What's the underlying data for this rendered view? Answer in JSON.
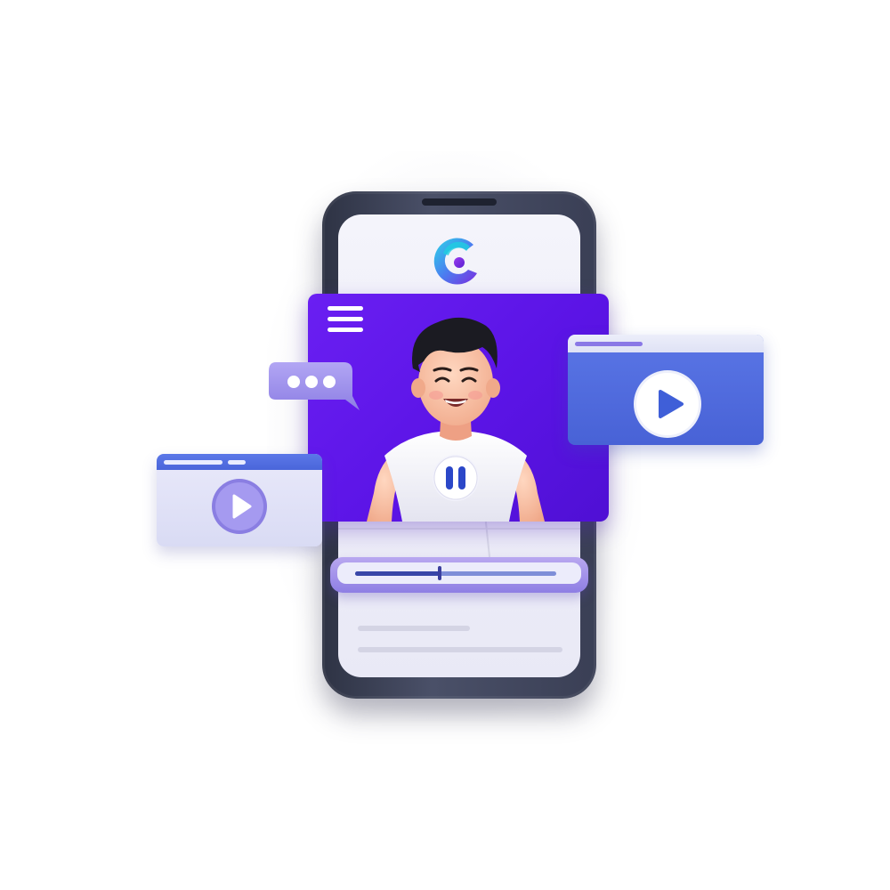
{
  "scene": "phone-video-app-illustration",
  "app_logo": {
    "icon": "c-logo-icon",
    "letter": "C"
  },
  "main_video": {
    "menu_icon": "hamburger-menu-icon",
    "control_icon": "pause-icon",
    "state": "playing"
  },
  "playback": {
    "progress": 0.42
  },
  "chat": {
    "icon": "chat-typing-icon"
  },
  "side_windows": [
    {
      "name": "right",
      "icon": "play-icon"
    },
    {
      "name": "left",
      "icon": "play-icon"
    }
  ],
  "colors": {
    "video_bg": "#5b14e6",
    "accent_blue": "#4a66da",
    "lavender": "#8e7ee4",
    "phone_frame": "#3a3f55",
    "screen": "#f0f0fa"
  }
}
